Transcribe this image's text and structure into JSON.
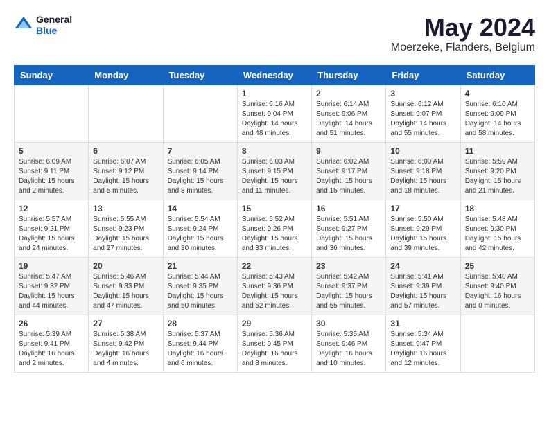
{
  "header": {
    "logo_line1": "General",
    "logo_line2": "Blue",
    "title": "May 2024",
    "subtitle": "Moerzeke, Flanders, Belgium"
  },
  "calendar": {
    "days_of_week": [
      "Sunday",
      "Monday",
      "Tuesday",
      "Wednesday",
      "Thursday",
      "Friday",
      "Saturday"
    ],
    "weeks": [
      [
        {
          "day": "",
          "info": ""
        },
        {
          "day": "",
          "info": ""
        },
        {
          "day": "",
          "info": ""
        },
        {
          "day": "1",
          "info": "Sunrise: 6:16 AM\nSunset: 9:04 PM\nDaylight: 14 hours\nand 48 minutes."
        },
        {
          "day": "2",
          "info": "Sunrise: 6:14 AM\nSunset: 9:06 PM\nDaylight: 14 hours\nand 51 minutes."
        },
        {
          "day": "3",
          "info": "Sunrise: 6:12 AM\nSunset: 9:07 PM\nDaylight: 14 hours\nand 55 minutes."
        },
        {
          "day": "4",
          "info": "Sunrise: 6:10 AM\nSunset: 9:09 PM\nDaylight: 14 hours\nand 58 minutes."
        }
      ],
      [
        {
          "day": "5",
          "info": "Sunrise: 6:09 AM\nSunset: 9:11 PM\nDaylight: 15 hours\nand 2 minutes."
        },
        {
          "day": "6",
          "info": "Sunrise: 6:07 AM\nSunset: 9:12 PM\nDaylight: 15 hours\nand 5 minutes."
        },
        {
          "day": "7",
          "info": "Sunrise: 6:05 AM\nSunset: 9:14 PM\nDaylight: 15 hours\nand 8 minutes."
        },
        {
          "day": "8",
          "info": "Sunrise: 6:03 AM\nSunset: 9:15 PM\nDaylight: 15 hours\nand 11 minutes."
        },
        {
          "day": "9",
          "info": "Sunrise: 6:02 AM\nSunset: 9:17 PM\nDaylight: 15 hours\nand 15 minutes."
        },
        {
          "day": "10",
          "info": "Sunrise: 6:00 AM\nSunset: 9:18 PM\nDaylight: 15 hours\nand 18 minutes."
        },
        {
          "day": "11",
          "info": "Sunrise: 5:59 AM\nSunset: 9:20 PM\nDaylight: 15 hours\nand 21 minutes."
        }
      ],
      [
        {
          "day": "12",
          "info": "Sunrise: 5:57 AM\nSunset: 9:21 PM\nDaylight: 15 hours\nand 24 minutes."
        },
        {
          "day": "13",
          "info": "Sunrise: 5:55 AM\nSunset: 9:23 PM\nDaylight: 15 hours\nand 27 minutes."
        },
        {
          "day": "14",
          "info": "Sunrise: 5:54 AM\nSunset: 9:24 PM\nDaylight: 15 hours\nand 30 minutes."
        },
        {
          "day": "15",
          "info": "Sunrise: 5:52 AM\nSunset: 9:26 PM\nDaylight: 15 hours\nand 33 minutes."
        },
        {
          "day": "16",
          "info": "Sunrise: 5:51 AM\nSunset: 9:27 PM\nDaylight: 15 hours\nand 36 minutes."
        },
        {
          "day": "17",
          "info": "Sunrise: 5:50 AM\nSunset: 9:29 PM\nDaylight: 15 hours\nand 39 minutes."
        },
        {
          "day": "18",
          "info": "Sunrise: 5:48 AM\nSunset: 9:30 PM\nDaylight: 15 hours\nand 42 minutes."
        }
      ],
      [
        {
          "day": "19",
          "info": "Sunrise: 5:47 AM\nSunset: 9:32 PM\nDaylight: 15 hours\nand 44 minutes."
        },
        {
          "day": "20",
          "info": "Sunrise: 5:46 AM\nSunset: 9:33 PM\nDaylight: 15 hours\nand 47 minutes."
        },
        {
          "day": "21",
          "info": "Sunrise: 5:44 AM\nSunset: 9:35 PM\nDaylight: 15 hours\nand 50 minutes."
        },
        {
          "day": "22",
          "info": "Sunrise: 5:43 AM\nSunset: 9:36 PM\nDaylight: 15 hours\nand 52 minutes."
        },
        {
          "day": "23",
          "info": "Sunrise: 5:42 AM\nSunset: 9:37 PM\nDaylight: 15 hours\nand 55 minutes."
        },
        {
          "day": "24",
          "info": "Sunrise: 5:41 AM\nSunset: 9:39 PM\nDaylight: 15 hours\nand 57 minutes."
        },
        {
          "day": "25",
          "info": "Sunrise: 5:40 AM\nSunset: 9:40 PM\nDaylight: 16 hours\nand 0 minutes."
        }
      ],
      [
        {
          "day": "26",
          "info": "Sunrise: 5:39 AM\nSunset: 9:41 PM\nDaylight: 16 hours\nand 2 minutes."
        },
        {
          "day": "27",
          "info": "Sunrise: 5:38 AM\nSunset: 9:42 PM\nDaylight: 16 hours\nand 4 minutes."
        },
        {
          "day": "28",
          "info": "Sunrise: 5:37 AM\nSunset: 9:44 PM\nDaylight: 16 hours\nand 6 minutes."
        },
        {
          "day": "29",
          "info": "Sunrise: 5:36 AM\nSunset: 9:45 PM\nDaylight: 16 hours\nand 8 minutes."
        },
        {
          "day": "30",
          "info": "Sunrise: 5:35 AM\nSunset: 9:46 PM\nDaylight: 16 hours\nand 10 minutes."
        },
        {
          "day": "31",
          "info": "Sunrise: 5:34 AM\nSunset: 9:47 PM\nDaylight: 16 hours\nand 12 minutes."
        },
        {
          "day": "",
          "info": ""
        }
      ]
    ]
  }
}
